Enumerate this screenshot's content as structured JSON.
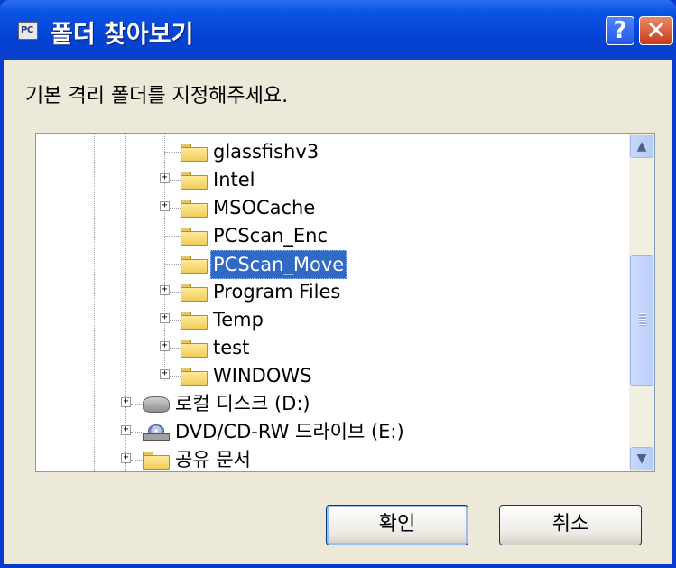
{
  "window": {
    "title": "폴더 찾아보기",
    "app_icon_text": "PC",
    "help": "?",
    "close": "✕"
  },
  "prompt": "기본 격리 폴더를 지정해주세요.",
  "tree": {
    "items": [
      {
        "label": "glassfishv3",
        "expander": "",
        "kind": "folder"
      },
      {
        "label": "Intel",
        "expander": "+",
        "kind": "folder"
      },
      {
        "label": "MSOCache",
        "expander": "+",
        "kind": "folder"
      },
      {
        "label": "PCScan_Enc",
        "expander": "",
        "kind": "folder"
      },
      {
        "label": "PCScan_Move",
        "expander": "",
        "kind": "folder",
        "selected": true
      },
      {
        "label": "Program Files",
        "expander": "+",
        "kind": "folder"
      },
      {
        "label": "Temp",
        "expander": "+",
        "kind": "folder"
      },
      {
        "label": "test",
        "expander": "+",
        "kind": "folder"
      },
      {
        "label": "WINDOWS",
        "expander": "+",
        "kind": "folder"
      },
      {
        "label": "로컬 디스크 (D:)",
        "expander": "+",
        "kind": "disk"
      },
      {
        "label": "DVD/CD-RW 드라이브 (E:)",
        "expander": "+",
        "kind": "dvd"
      },
      {
        "label": "공유 문서",
        "expander": "+",
        "kind": "folder"
      }
    ]
  },
  "scrollbar": {
    "up": "▲",
    "down": "▼"
  },
  "buttons": {
    "ok": "확인",
    "cancel": "취소"
  },
  "colors": {
    "titlebar": "#0a54e3",
    "selection": "#316ac5",
    "dialog_bg": "#ece9d8"
  }
}
